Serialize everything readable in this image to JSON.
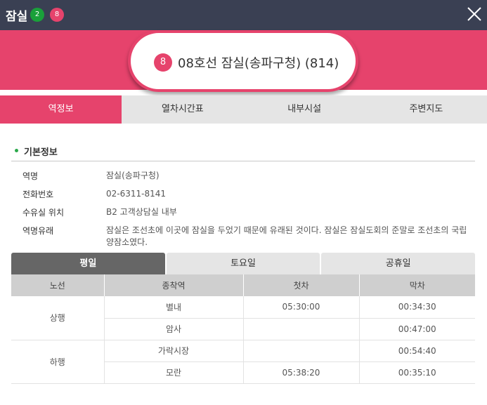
{
  "window": {
    "station_short": "잠실",
    "lines": [
      {
        "num": "2",
        "color": "#1aa03a"
      },
      {
        "num": "8",
        "color": "#e6436c"
      }
    ]
  },
  "header": {
    "line_num": "8",
    "station_full": "08호선 잠실(송파구청) (814)"
  },
  "tabs": [
    "역정보",
    "열차시간표",
    "내부시설",
    "주변지도"
  ],
  "section": {
    "title": "기본정보"
  },
  "info": [
    {
      "label": "역명",
      "value": "잠실(송파구청)"
    },
    {
      "label": "전화번호",
      "value": "02-6311-8141"
    },
    {
      "label": "수유실 위치",
      "value": "B2 고객상담실 내부"
    },
    {
      "label": "역명유래",
      "value": "잠실은 조선초에 이곳에 잠실을 두었기 때문에 유래된 것이다. 잠실은 잠실도회의 준말로 조선초의 국립양잠소였다."
    }
  ],
  "day_tabs": [
    "평일",
    "토요일",
    "공휴일"
  ],
  "timetable": {
    "headers": [
      "노선",
      "종착역",
      "첫차",
      "막차"
    ],
    "groups": [
      {
        "direction": "상행",
        "rows": [
          {
            "terminal": "별내",
            "first": "05:30:00",
            "last": "00:34:30"
          },
          {
            "terminal": "암사",
            "first": "",
            "last": "00:47:00"
          }
        ]
      },
      {
        "direction": "하행",
        "rows": [
          {
            "terminal": "가락시장",
            "first": "",
            "last": "00:54:40"
          },
          {
            "terminal": "모란",
            "first": "05:38:20",
            "last": "00:35:10"
          }
        ]
      }
    ]
  },
  "colors": {
    "accent": "#e6436c",
    "topbar": "#3a4053",
    "line2": "#1aa03a"
  }
}
